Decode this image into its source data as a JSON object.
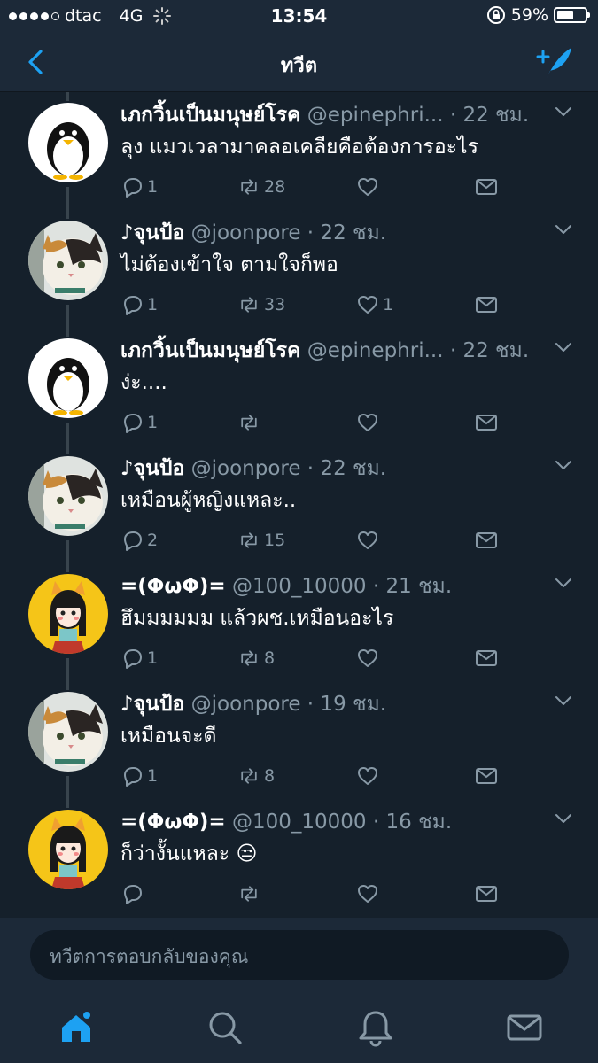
{
  "status_bar": {
    "carrier": "dtac",
    "network": "4G",
    "time": "13:54",
    "battery_percent": "59%",
    "battery_level": 0.59
  },
  "nav": {
    "title": "ทวีต",
    "back_icon": "chevron-left-icon",
    "compose_icon": "compose-tweet-icon",
    "accent_color": "#1da1f2"
  },
  "tweets": [
    {
      "name": "เภกวิ้นเป็นมนุษย์โรค",
      "handle": "@epinephri...",
      "time": "· 22 ชม.",
      "text": "ลุง แมวเวลามาคลอเคลียคือต้องการอะไร",
      "replies": "1",
      "retweets": "28",
      "likes": "",
      "avatar": "penguin"
    },
    {
      "name": "♪จุนป้อ",
      "handle": "@joonpore",
      "time": "· 22 ชม.",
      "text": "ไม่ต้องเข้าใจ ตามใจก็พอ",
      "replies": "1",
      "retweets": "33",
      "likes": "1",
      "avatar": "cat"
    },
    {
      "name": "เภกวิ้นเป็นมนุษย์โรค",
      "handle": "@epinephri...",
      "time": "· 22 ชม.",
      "text": "ง่ะ....",
      "replies": "1",
      "retweets": "",
      "likes": "",
      "avatar": "penguin"
    },
    {
      "name": "♪จุนป้อ",
      "handle": "@joonpore",
      "time": "· 22 ชม.",
      "text": "เหมือนผู้หญิงแหละ..",
      "replies": "2",
      "retweets": "15",
      "likes": "",
      "avatar": "cat"
    },
    {
      "name": "=(ΦωΦ)=",
      "handle": "@100_10000",
      "time": "· 21 ชม.",
      "text": "ฮึมมมมมม แล้วผช.เหมือนอะไร",
      "replies": "1",
      "retweets": "8",
      "likes": "",
      "avatar": "girl"
    },
    {
      "name": "♪จุนป้อ",
      "handle": "@joonpore",
      "time": "· 19 ชม.",
      "text": "เหมือนจะดี",
      "replies": "1",
      "retweets": "8",
      "likes": "",
      "avatar": "cat"
    },
    {
      "name": "=(ΦωΦ)=",
      "handle": "@100_10000",
      "time": "· 16 ชม.",
      "text": "ก็ว่างั้นแหละ 😒",
      "replies": "",
      "retweets": "",
      "likes": "",
      "avatar": "girl"
    }
  ],
  "reply": {
    "placeholder": "ทวีตการตอบกลับของคุณ"
  },
  "tabs": [
    {
      "name": "home",
      "icon": "home-icon",
      "active": true
    },
    {
      "name": "search",
      "icon": "search-icon",
      "active": false
    },
    {
      "name": "notifications",
      "icon": "bell-icon",
      "active": false
    },
    {
      "name": "messages",
      "icon": "mail-icon",
      "active": false
    }
  ]
}
